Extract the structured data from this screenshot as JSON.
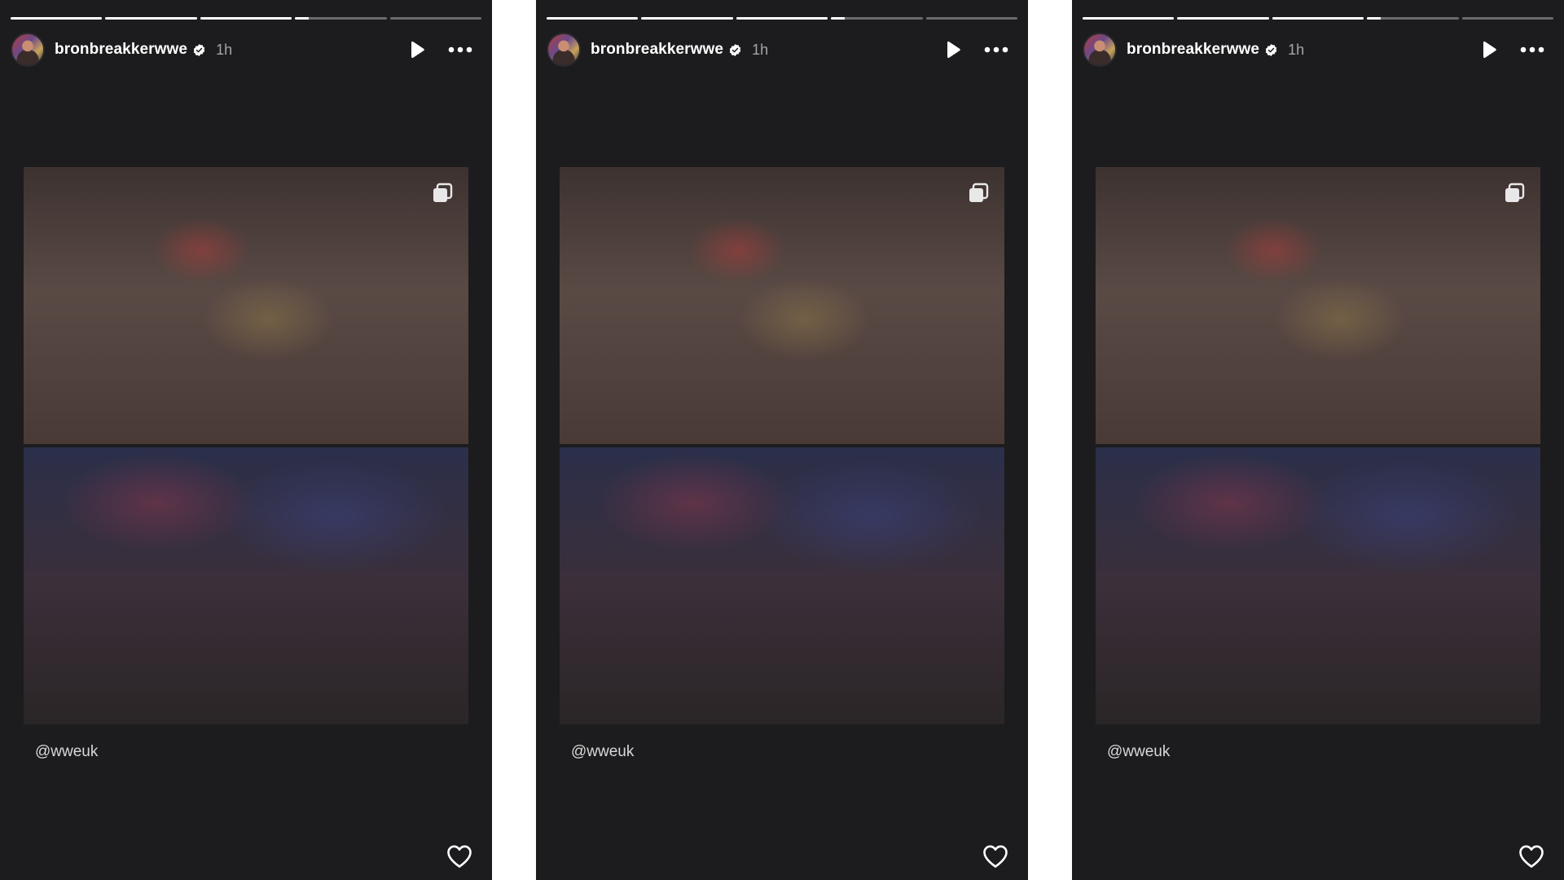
{
  "stories": [
    {
      "username": "bronbreakkerwwe",
      "time": "1h",
      "mention": "@wweuk",
      "progress": [
        1,
        1,
        1,
        0.15,
        0
      ]
    },
    {
      "username": "bronbreakkerwwe",
      "time": "1h",
      "mention": "@wweuk",
      "progress": [
        1,
        1,
        1,
        0.15,
        0
      ]
    },
    {
      "username": "bronbreakkerwwe",
      "time": "1h",
      "mention": "@wweuk",
      "progress": [
        1,
        1,
        1,
        0.15,
        0
      ]
    }
  ],
  "icons": {
    "verified": "verified-badge-icon",
    "play": "play-icon",
    "more": "more-options-icon",
    "carousel": "carousel-icon",
    "like": "heart-icon"
  },
  "colors": {
    "background": "#1c1c1e",
    "text": "#ffffff",
    "muted_text": "#999999"
  }
}
